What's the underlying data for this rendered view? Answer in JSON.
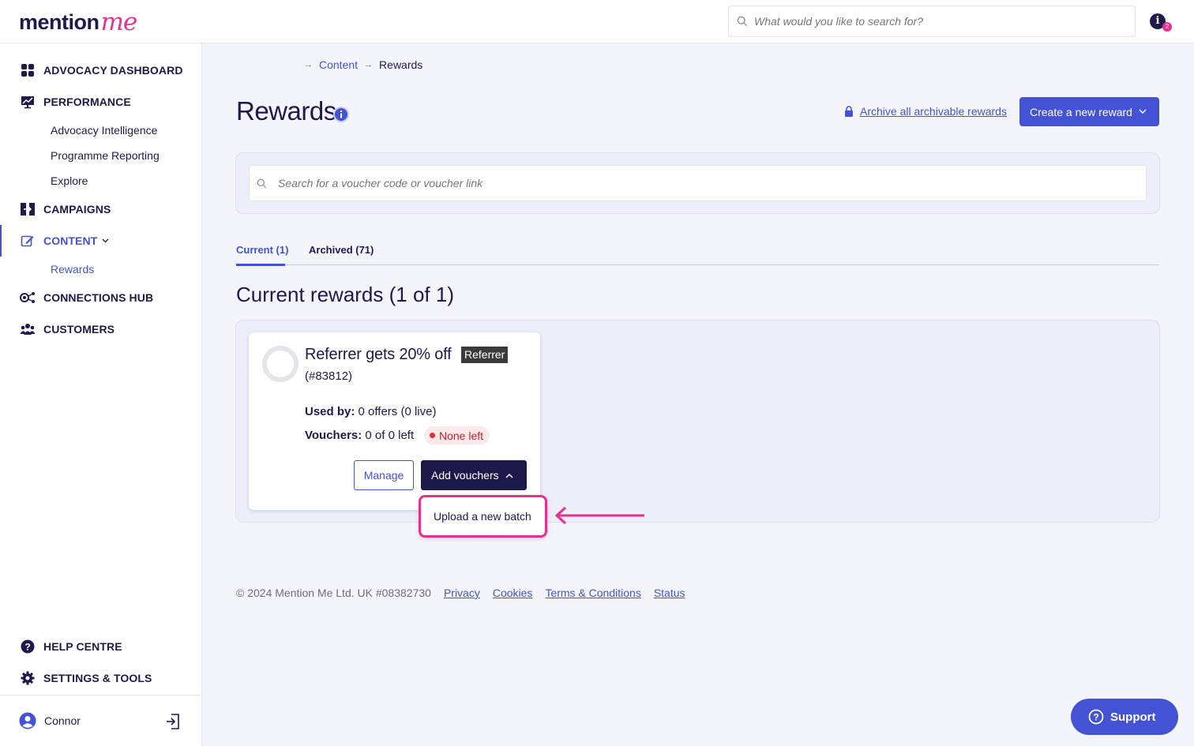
{
  "header": {
    "logo_word": "mention",
    "logo_me": "me",
    "search_placeholder": "What would you like to search for?",
    "notification_icon_glyph": "i",
    "notification_count": "2"
  },
  "sidebar": {
    "items": [
      {
        "label": "ADVOCACY DASHBOARD",
        "icon": "dashboard-icon"
      },
      {
        "label": "PERFORMANCE",
        "icon": "performance-icon"
      },
      {
        "label": "Advocacy Intelligence"
      },
      {
        "label": "Programme Reporting"
      },
      {
        "label": "Explore"
      },
      {
        "label": "CAMPAIGNS",
        "icon": "campaigns-icon"
      },
      {
        "label": "CONTENT",
        "icon": "content-icon"
      },
      {
        "label": "Rewards"
      },
      {
        "label": "CONNECTIONS HUB",
        "icon": "connections-icon"
      },
      {
        "label": "CUSTOMERS",
        "icon": "customers-icon"
      }
    ],
    "bottom": [
      {
        "label": "HELP CENTRE",
        "icon": "help-icon"
      },
      {
        "label": "SETTINGS & TOOLS",
        "icon": "gear-icon"
      }
    ],
    "user": {
      "name": "Connor"
    }
  },
  "breadcrumb": {
    "content": "Content",
    "current": "Rewards"
  },
  "page": {
    "title": "Rewards",
    "archive_link": "Archive all archivable rewards",
    "create_button": "Create a new reward",
    "search_placeholder": "Search for a voucher code or voucher link"
  },
  "tabs": [
    {
      "label": "Current (1)",
      "active": true
    },
    {
      "label": "Archived (71)",
      "active": false
    }
  ],
  "section_title": "Current rewards (1 of 1)",
  "reward": {
    "title": "Referrer gets 20% off",
    "tag": "Referrer",
    "id": "(#83812)",
    "used_label": "Used by:",
    "used_value": " 0 offers (0 live)",
    "vouchers_label": "Vouchers:",
    "vouchers_value": " 0 of 0 left",
    "status": "None left",
    "manage_button": "Manage",
    "add_button": "Add vouchers",
    "dropdown_item": "Upload a new batch"
  },
  "footer": {
    "copyright": "© 2024 Mention Me Ltd. UK #08382730",
    "links": [
      "Privacy",
      "Cookies",
      "Terms & Conditions",
      "Status"
    ]
  },
  "support": {
    "label": "Support"
  },
  "colors": {
    "brand_navy": "#1d1a4b",
    "accent_blue": "#4452d6",
    "brand_pink": "#e8318c",
    "status_red": "#c0242c"
  }
}
